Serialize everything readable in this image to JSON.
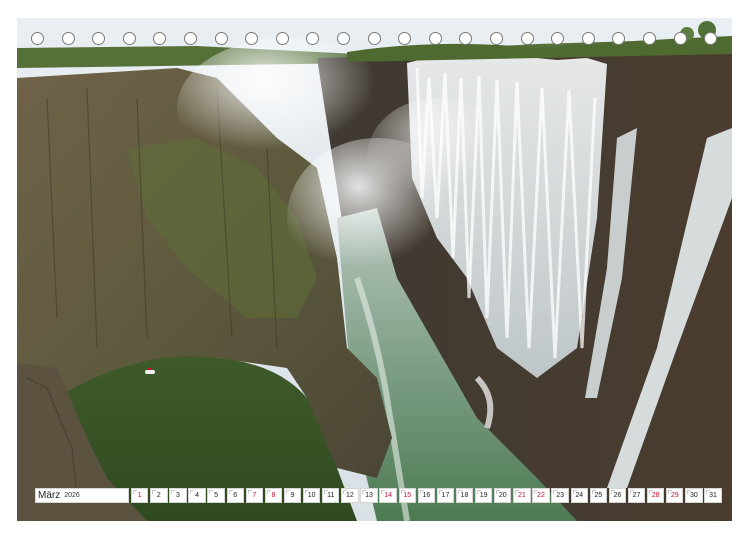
{
  "calendar": {
    "month": "März",
    "year": "2026",
    "days": [
      {
        "n": "1",
        "weekend": true
      },
      {
        "n": "2",
        "weekend": false
      },
      {
        "n": "3",
        "weekend": false
      },
      {
        "n": "4",
        "weekend": false
      },
      {
        "n": "5",
        "weekend": false
      },
      {
        "n": "6",
        "weekend": false
      },
      {
        "n": "7",
        "weekend": true
      },
      {
        "n": "8",
        "weekend": true
      },
      {
        "n": "9",
        "weekend": false
      },
      {
        "n": "10",
        "weekend": false
      },
      {
        "n": "11",
        "weekend": false
      },
      {
        "n": "12",
        "weekend": false
      },
      {
        "n": "13",
        "weekend": false
      },
      {
        "n": "14",
        "weekend": true
      },
      {
        "n": "15",
        "weekend": true
      },
      {
        "n": "16",
        "weekend": false
      },
      {
        "n": "17",
        "weekend": false
      },
      {
        "n": "18",
        "weekend": false
      },
      {
        "n": "19",
        "weekend": false
      },
      {
        "n": "20",
        "weekend": false
      },
      {
        "n": "21",
        "weekend": true
      },
      {
        "n": "22",
        "weekend": true
      },
      {
        "n": "23",
        "weekend": false
      },
      {
        "n": "24",
        "weekend": false
      },
      {
        "n": "25",
        "weekend": false
      },
      {
        "n": "26",
        "weekend": false
      },
      {
        "n": "27",
        "weekend": false
      },
      {
        "n": "28",
        "weekend": true
      },
      {
        "n": "29",
        "weekend": true
      },
      {
        "n": "30",
        "weekend": false
      },
      {
        "n": "31",
        "weekend": false
      }
    ]
  },
  "colors": {
    "weekend_text": "#c8102e",
    "cell_border": "#d5d5d5",
    "ring_border": "#7a7a7a"
  },
  "binding_holes": 23
}
